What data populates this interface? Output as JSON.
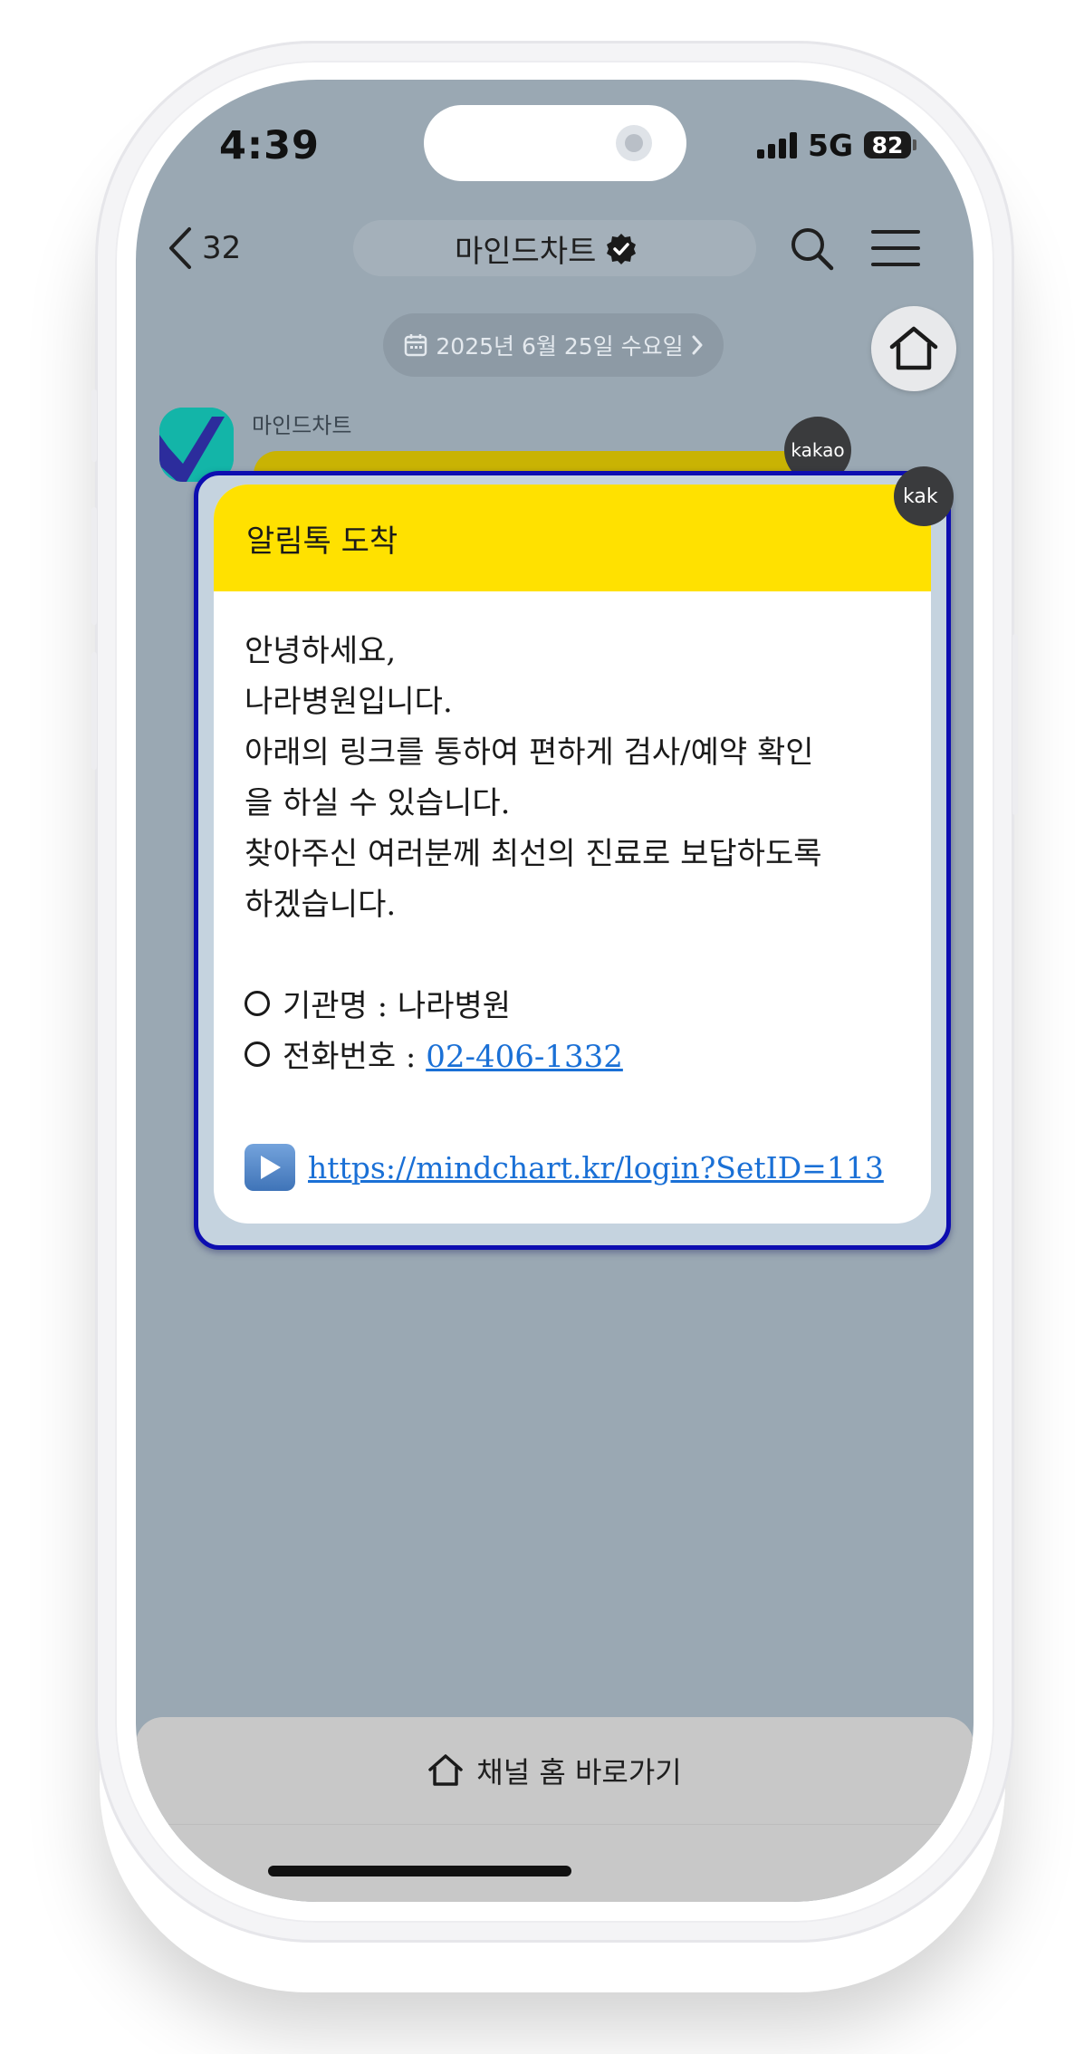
{
  "status_bar": {
    "time": "4:39",
    "network": "5G",
    "battery": "82"
  },
  "nav": {
    "back_count": "32",
    "title": "마인드차트"
  },
  "chat": {
    "date_label": "2025년 6월 25일 수요일",
    "sender_name": "마인드차트",
    "badge_label": "kakao",
    "badge_label_cut": "kak"
  },
  "message": {
    "header": "알림톡 도착",
    "lines": [
      "안녕하세요,",
      "나라병원입니다.",
      "아래의 링크를 통하여 편하게 검사/예약 확인",
      "을 하실 수 있습니다.",
      "찾아주신 여러분께 최선의 진료로 보답하도록",
      "하겠습니다."
    ],
    "org_label": "기관명  : 나라병원",
    "phone_label": "전화번호 : ",
    "phone_number": "02-406-1332",
    "url": "https://mindchart.kr/login?SetID=113"
  },
  "bottom": {
    "channel_home_label": "채널 홈 바로가기"
  },
  "colors": {
    "screen_bg": "#9aa8b3",
    "alimtalk_yellow": "#ffe100",
    "overlay_border": "#0d0db0",
    "link_blue": "#1a70d6"
  }
}
